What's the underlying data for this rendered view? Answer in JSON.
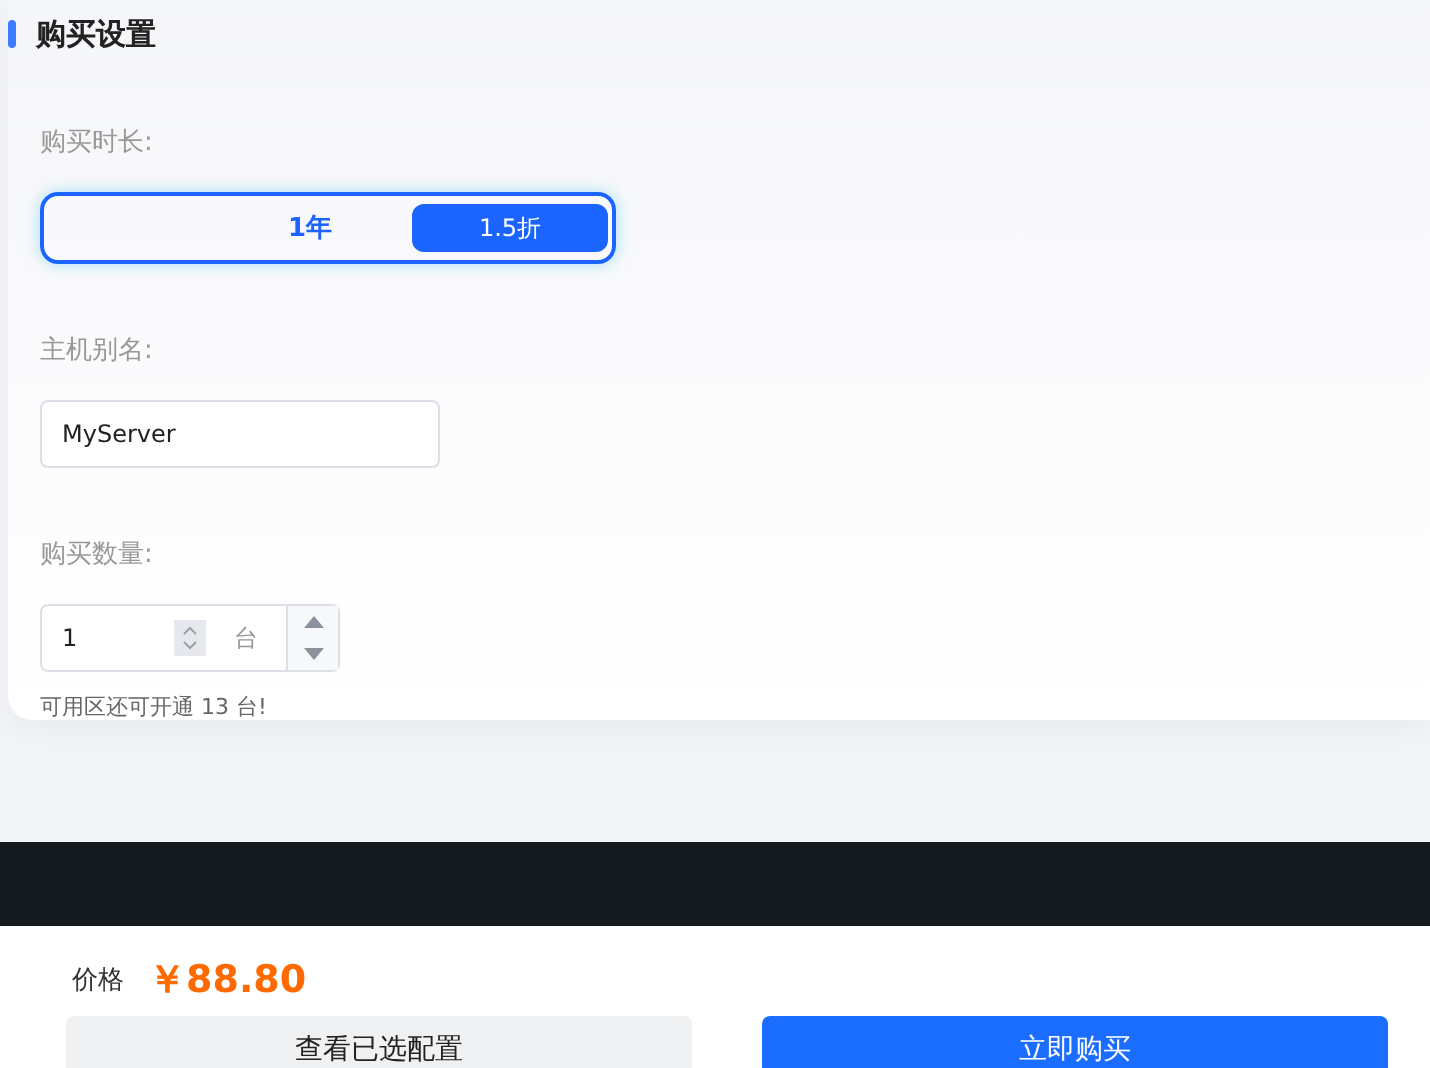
{
  "section": {
    "title": "购买设置"
  },
  "duration": {
    "label": "购买时长:",
    "options": [
      {
        "label": "1年",
        "badge": "1.5折",
        "selected": true
      }
    ]
  },
  "alias": {
    "label": "主机别名:",
    "value": "MyServer"
  },
  "quantity": {
    "label": "购买数量:",
    "value": "1",
    "unit": "台",
    "hint": "可用区还可开通 13 台!"
  },
  "footer": {
    "price_label": "价格",
    "price": "￥88.80",
    "buttons": [
      {
        "label": "查看已选配置",
        "kind": "secondary"
      },
      {
        "label": "立即购买",
        "kind": "primary"
      }
    ]
  }
}
